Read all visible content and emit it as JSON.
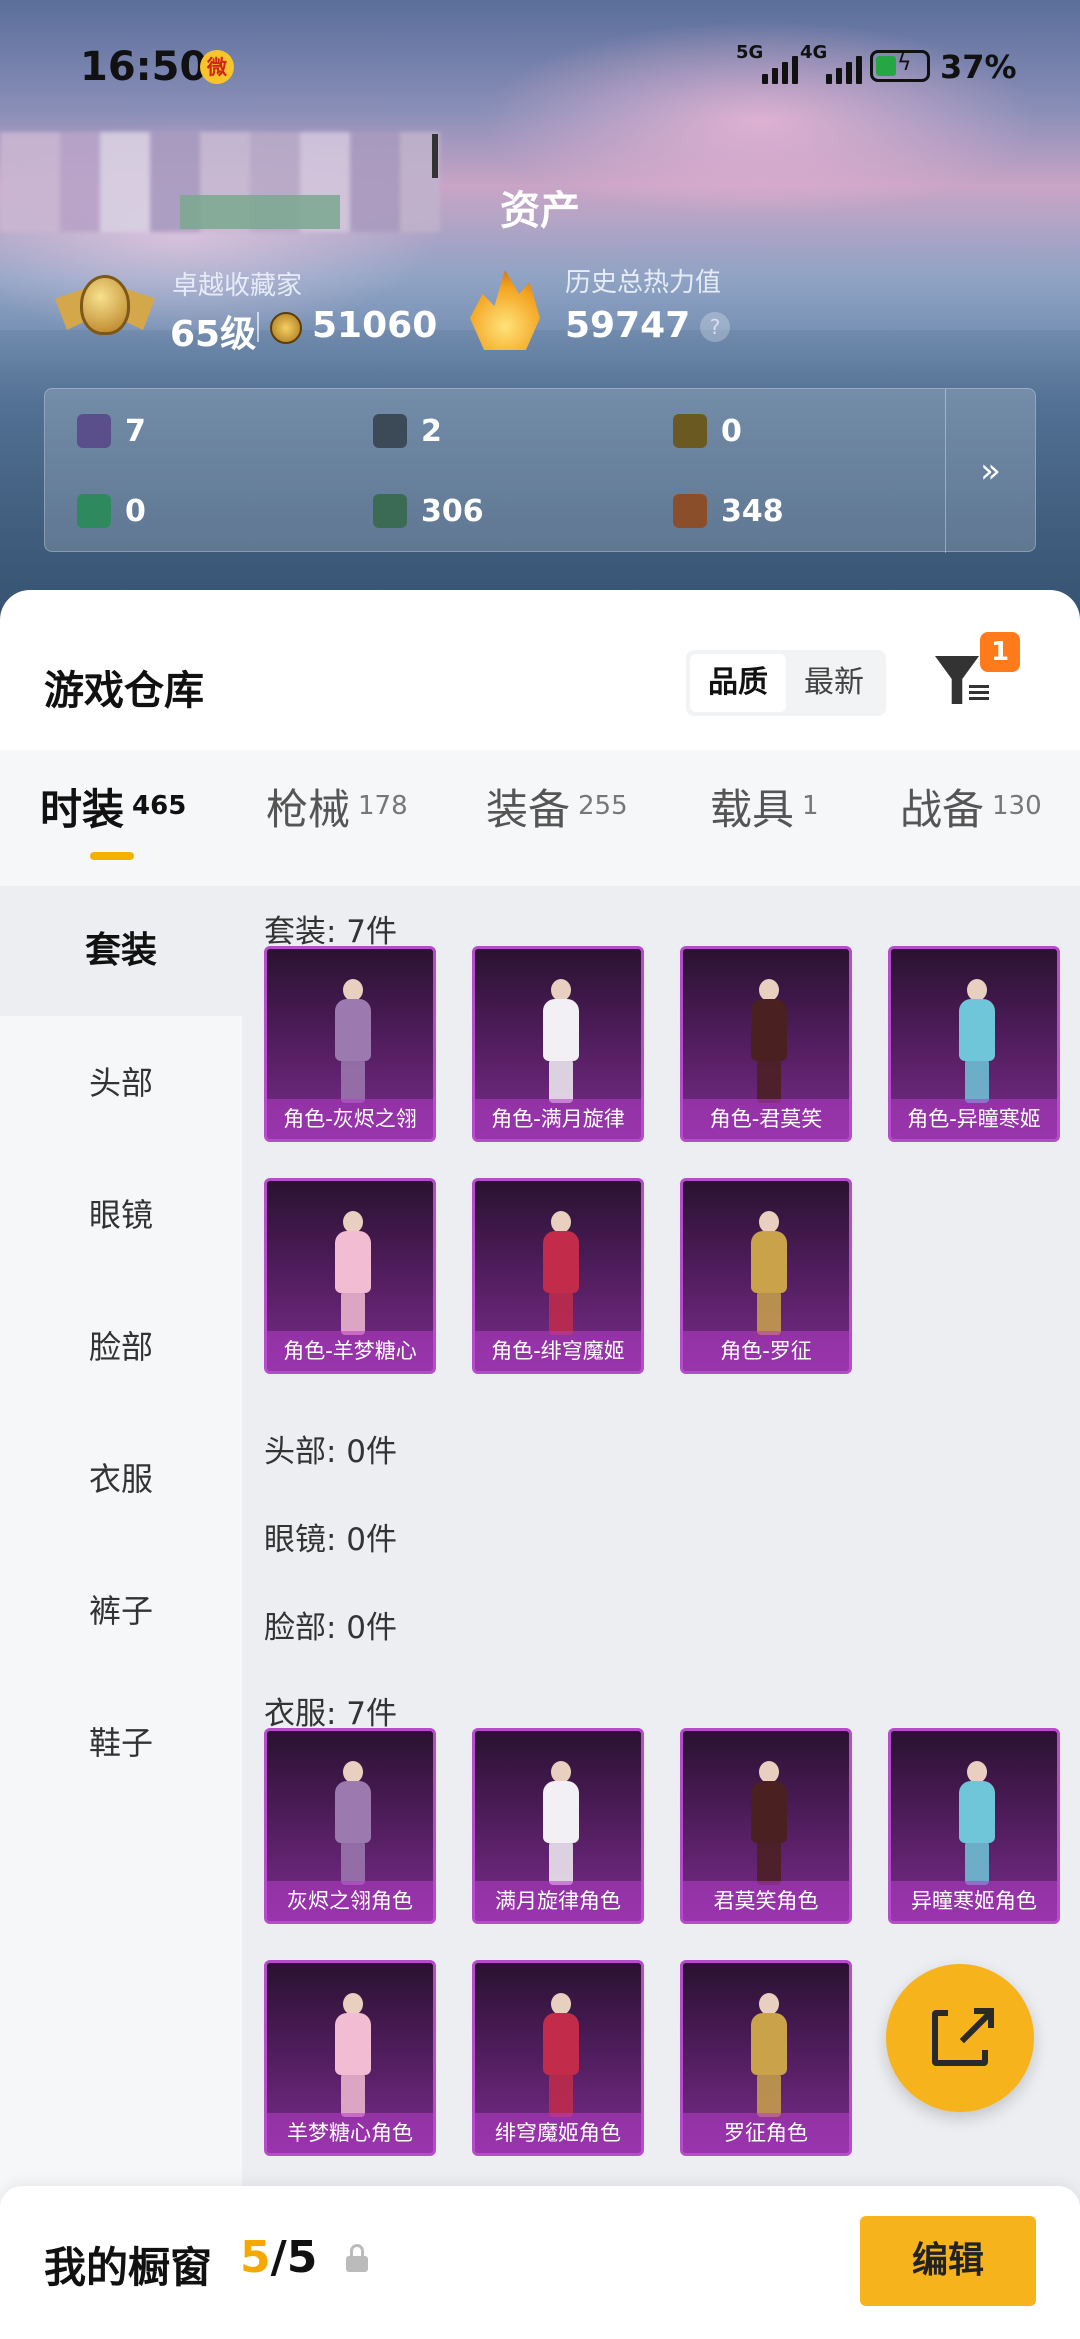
{
  "status_bar": {
    "time": "16:50",
    "net1": "5G",
    "net2": "4G",
    "battery_pct": "37%"
  },
  "header": {
    "title": "资产",
    "level_label": "卓越收藏家",
    "level_value": "65级",
    "coins": "51060",
    "heat_label": "历史总热力值",
    "heat_value": "59747",
    "help": "?"
  },
  "assets": [
    {
      "icon": "card-icon",
      "value": "7",
      "color": "#5a4f8a"
    },
    {
      "icon": "gear-token-icon",
      "value": "2",
      "color": "#3c4a58"
    },
    {
      "icon": "gold-emblem-icon",
      "value": "0",
      "color": "#6a5a22"
    },
    {
      "icon": "green-ticket-icon",
      "value": "0",
      "color": "#2e8a5e"
    },
    {
      "icon": "green-orb-icon",
      "value": "306",
      "color": "#3b6b55"
    },
    {
      "icon": "bronze-coin-icon",
      "value": "348",
      "color": "#8a4f2a"
    }
  ],
  "assets_more": "»",
  "warehouse": {
    "title": "游戏仓库",
    "sort_quality": "品质",
    "sort_latest": "最新",
    "filter_badge": "1"
  },
  "tabs": [
    {
      "label": "时装",
      "count": "465"
    },
    {
      "label": "枪械",
      "count": "178"
    },
    {
      "label": "装备",
      "count": "255"
    },
    {
      "label": "载具",
      "count": "1"
    },
    {
      "label": "战备",
      "count": "130"
    }
  ],
  "categories": [
    "套装",
    "头部",
    "眼镜",
    "脸部",
    "衣服",
    "裤子",
    "鞋子"
  ],
  "sections": {
    "suits": "套装: 7件",
    "head": "头部: 0件",
    "glasses": "眼镜: 0件",
    "face": "脸部: 0件",
    "clothes": "衣服: 7件"
  },
  "suit_items": [
    "角色-灰烬之翎",
    "角色-满月旋律",
    "角色-君莫笑",
    "角色-异瞳寒姬",
    "角色-羊梦糖心",
    "角色-绯穹魔姬",
    "角色-罗征"
  ],
  "clothes_items": [
    "灰烬之翎角色",
    "满月旋律角色",
    "君莫笑角色",
    "异瞳寒姬角色",
    "羊梦糖心角色",
    "绯穹魔姬角色",
    "罗征角色"
  ],
  "figure_colors": [
    "#9c7ab0",
    "#f2f0f4",
    "#4a2020",
    "#6fc6d8",
    "#f2bcd2",
    "#c22b4a",
    "#c9a24a"
  ],
  "showcase": {
    "label": "我的橱窗",
    "current": "5",
    "total": "/5",
    "edit": "编辑"
  }
}
